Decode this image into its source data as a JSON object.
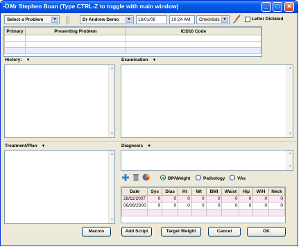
{
  "window": {
    "title": "Mr Stephen Boan (Type CTRL-Z to toggle with main window)",
    "app_icon": "-D",
    "controls": {
      "minimize": "_",
      "maximize": "□",
      "close": "✕"
    }
  },
  "toolbar": {
    "problem_select": "Select a Problem",
    "doctor_select": "Dr Andrew Demo",
    "date": "16/01/08",
    "time": "10:24 AM",
    "checklists": "Checklists",
    "brush_icon": "paint-brush",
    "letter_dictated": "Letter Dictated",
    "letter_dictated_checked": false
  },
  "problems_grid": {
    "headers": [
      "Primary",
      "Presenting Problem",
      "ICD10 Code"
    ]
  },
  "sections": {
    "history": "History:",
    "examination": "Examination",
    "treatment": "Treatment/Plan",
    "diagnosis": "Diagnosis"
  },
  "icons": [
    "add-icon",
    "trash-icon",
    "pie-chart-icon"
  ],
  "radio_options": [
    {
      "label": "BP/Weight",
      "selected": true
    },
    {
      "label": "Pathology",
      "selected": false
    },
    {
      "label": "VAs",
      "selected": false
    }
  ],
  "vitals": {
    "headers": [
      "Date",
      "Sys",
      "Dias",
      "Ht",
      "Wt",
      "BMI",
      "Waist",
      "Hip",
      "W/H",
      "Neck"
    ],
    "rows": [
      [
        "28/11/2007",
        "0",
        "0",
        "0",
        "0",
        "0",
        "0",
        "0",
        "0",
        "0"
      ],
      [
        "06/06/2000",
        "0",
        "0",
        "0",
        "0",
        "0",
        "0",
        "0",
        "0",
        "0"
      ]
    ]
  },
  "buttons": {
    "macros": "Macros",
    "add_script": "Add Script",
    "target_weight": "Target Weight",
    "cancel": "Cancel",
    "ok": "OK"
  },
  "colors": {
    "titlebar": "#0a5fe5",
    "face": "#ece9d8",
    "pink_row": "#fbe6f3",
    "blue_row": "#e8ecfb"
  }
}
